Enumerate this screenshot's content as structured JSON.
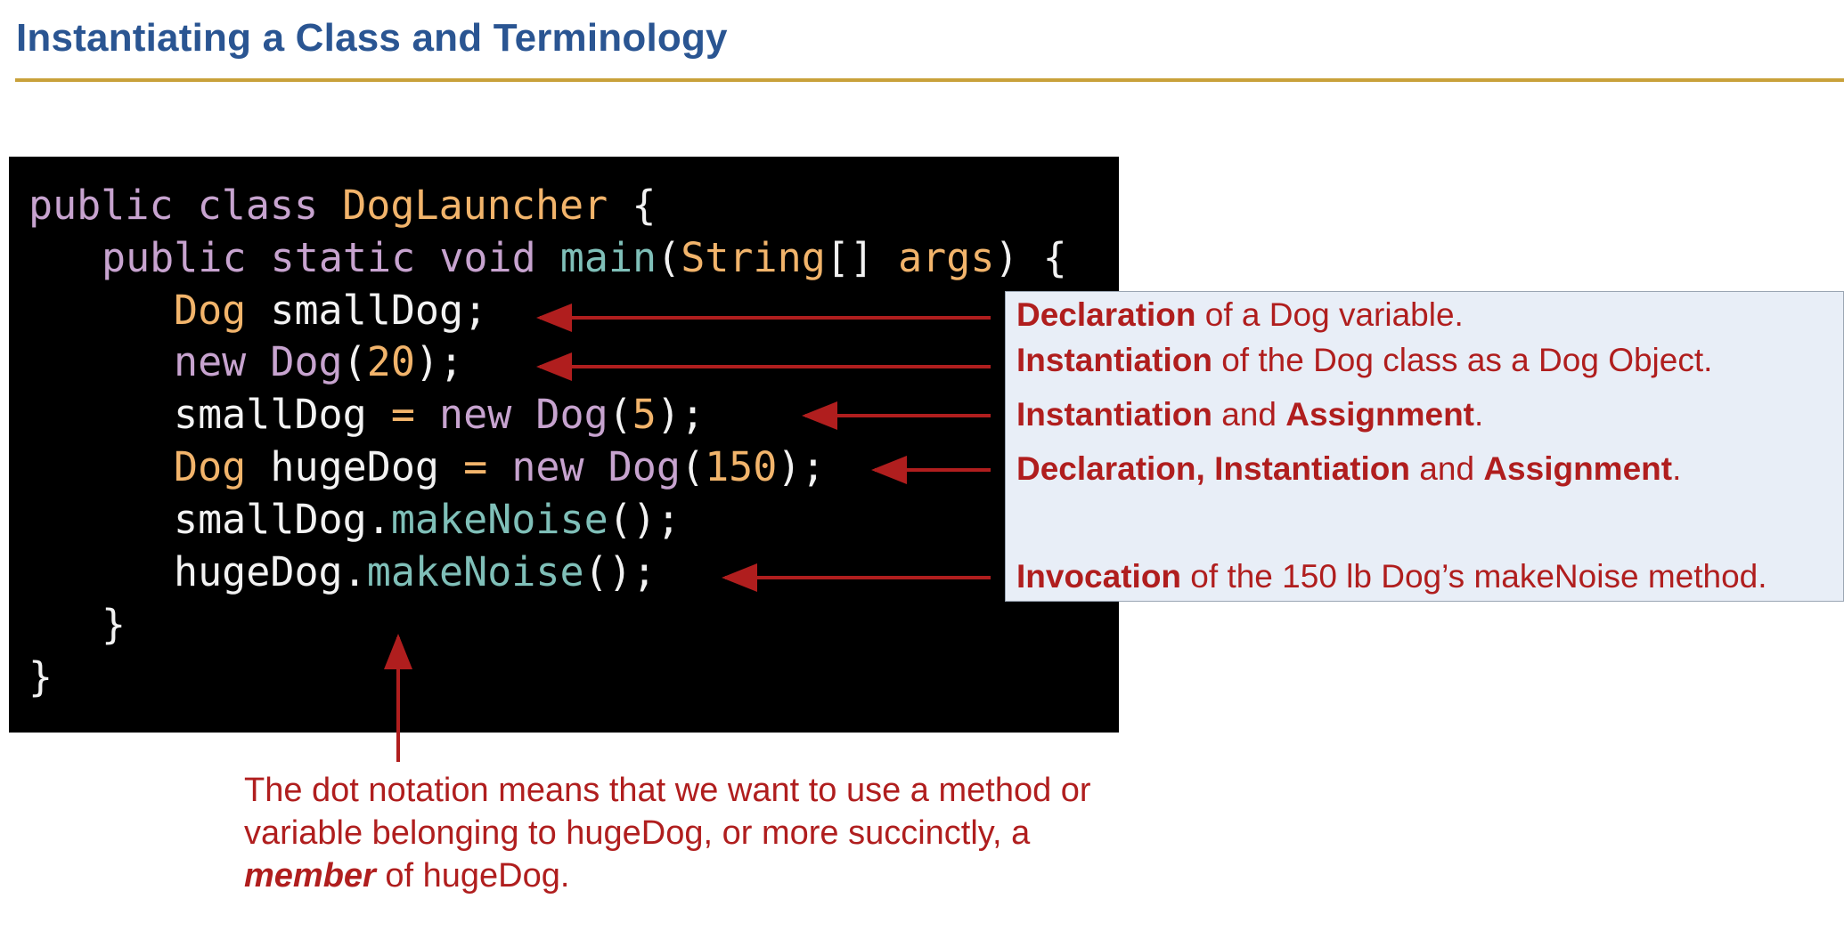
{
  "slide": {
    "title": "Instantiating a Class and Terminology"
  },
  "colors": {
    "title": "#2a5592",
    "title_rule": "#c9a13b",
    "code_background": "#000000",
    "keyword": "#c7a3cf",
    "type": "#f2b46b",
    "method": "#7fbfb8",
    "annotation": "#b01e1e",
    "callout_background": "#e8eef7"
  },
  "code": {
    "line1": {
      "public": "public",
      "class": "class",
      "name": "DogLauncher",
      "brace": " {"
    },
    "line2": {
      "public": "public",
      "static": "static",
      "void": "void",
      "main": "main",
      "open": "(",
      "string": "String",
      "arr": "[] ",
      "args": "args",
      "close": ") {"
    },
    "line3": {
      "type": "Dog",
      "rest": " smallDog;"
    },
    "line4": {
      "new": "new",
      "cls": "Dog",
      "open": "(",
      "num": "20",
      "close": ");"
    },
    "line5": {
      "var": "smallDog",
      "eq": " = ",
      "new": "new",
      "cls": "Dog",
      "open": "(",
      "num": "5",
      "close": ");"
    },
    "line6": {
      "type": "Dog",
      "var": " hugeDog",
      "eq": " = ",
      "new": "new",
      "cls": "Dog",
      "open": "(",
      "num": "150",
      "close": ");"
    },
    "line7": {
      "obj": "smallDog.",
      "method": "makeNoise",
      "call": "();"
    },
    "line8": {
      "obj": "hugeDog.",
      "method": "makeNoise",
      "call": "();"
    },
    "line9": {
      "brace": "}"
    },
    "line10": {
      "brace": "}"
    }
  },
  "callouts": {
    "c1": {
      "bold": "Declaration",
      "rest": " of a Dog variable."
    },
    "c2": {
      "bold": "Instantiation",
      "rest": " of the Dog class as a Dog Object."
    },
    "c3": {
      "bold1": "Instantiation",
      "mid": " and ",
      "bold2": "Assignment",
      "end": "."
    },
    "c4": {
      "bold1": "Declaration, Instantiation",
      "mid": " and ",
      "bold2": "Assignment",
      "end": "."
    },
    "c5": {
      "bold": "Invocation",
      "rest": " of the 150 lb Dog’s makeNoise method."
    }
  },
  "member_note": {
    "text1": "The dot notation means that we want to use a method or variable belonging to hugeDog, or more succinctly, a ",
    "bold": "member",
    "text2": " of hugeDog."
  }
}
